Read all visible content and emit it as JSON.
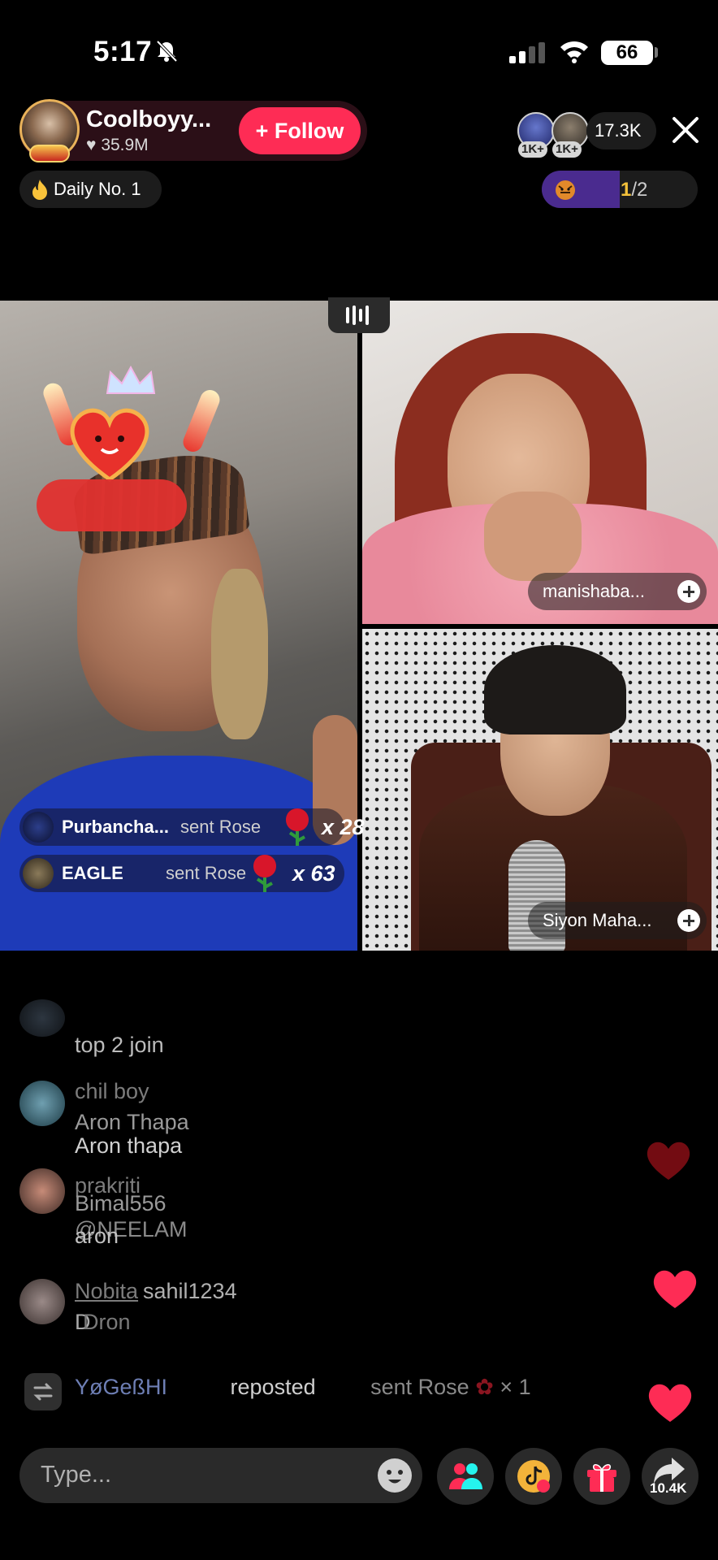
{
  "status_bar": {
    "time": "5:17",
    "battery": "66"
  },
  "host": {
    "name": "Coolboyy...",
    "likes": "35.9M",
    "follow_label": "+ Follow",
    "daily_rank": "Daily No. 1"
  },
  "viewers": {
    "badge_1": "1K+",
    "badge_2": "1K+",
    "count": "17.3K"
  },
  "ranking": {
    "current": "1",
    "total": "/2",
    "progress": 0.5
  },
  "guests": [
    {
      "name": "manishaba..."
    },
    {
      "name": "Siyon Maha..."
    }
  ],
  "gifts": [
    {
      "user": "Purbancha...",
      "action": "sent Rose",
      "count": "x 28"
    },
    {
      "user": "EAGLE",
      "action": "sent Rose",
      "count": "x 63"
    }
  ],
  "comments": [
    {
      "name": "",
      "text": "top 2 join"
    },
    {
      "name": "chil boy",
      "text": ""
    },
    {
      "name": "Aron Thapa",
      "text": "Aron thapa"
    },
    {
      "name": "prakriti",
      "text": ""
    },
    {
      "name": "Bimal556",
      "text": "@NEELAM"
    },
    {
      "name": "",
      "text": "aron"
    },
    {
      "name": "Nobita",
      "text": "sahil1234"
    },
    {
      "name": "",
      "text": "D"
    },
    {
      "name": "",
      "text": "Dron"
    }
  ],
  "share_event": {
    "user": "YøGeßHI",
    "action": "reposted",
    "gift_action": "sent Rose",
    "gift_count": "× 1"
  },
  "composer": {
    "placeholder": "Type..."
  },
  "actions": {
    "share_count": "10.4K"
  },
  "colors": {
    "follow": "#fe2c55",
    "accent": "#f3c13a",
    "heart": "#fe2c55"
  }
}
